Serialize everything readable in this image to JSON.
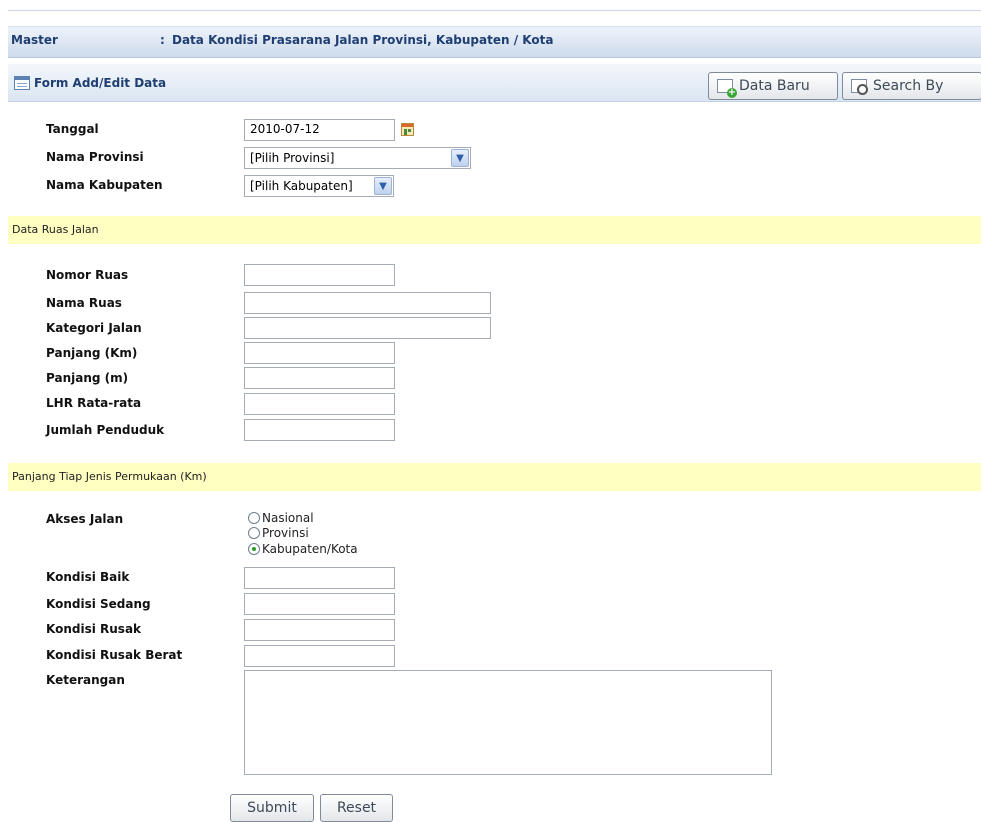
{
  "header": {
    "master_label": "Master",
    "separator": ":",
    "title": "Data Kondisi Prasarana Jalan Provinsi, Kabupaten / Kota"
  },
  "formbar": {
    "title": "Form Add/Edit Data",
    "new_button": "Data Baru",
    "search_button": "Search By"
  },
  "general": {
    "tanggal_label": "Tanggal",
    "tanggal_value": "2010-07-12",
    "provinsi_label": "Nama Provinsi",
    "provinsi_value": "[Pilih Provinsi]",
    "kabupaten_label": "Nama Kabupaten",
    "kabupaten_value": "[Pilih Kabupaten]"
  },
  "ruas_section": {
    "title": "Data Ruas Jalan",
    "nomor_ruas": "Nomor Ruas",
    "nama_ruas": "Nama Ruas",
    "kategori_jalan": "Kategori Jalan",
    "panjang_km": "Panjang (Km)",
    "panjang_m": "Panjang (m)",
    "lhr": "LHR Rata-rata",
    "jumlah_penduduk": "Jumlah Penduduk"
  },
  "permukaan_section": {
    "title": "Panjang Tiap Jenis Permukaan (Km)",
    "akses_jalan": "Akses Jalan",
    "radio_options": [
      "Nasional",
      "Provinsi",
      "Kabupaten/Kota"
    ],
    "selected": "Kabupaten/Kota",
    "kondisi_baik": "Kondisi Baik",
    "kondisi_sedang": "Kondisi Sedang",
    "kondisi_rusak": "Kondisi Rusak",
    "kondisi_rusak_berat": "Kondisi Rusak Berat",
    "keterangan": "Keterangan"
  },
  "actions": {
    "submit": "Submit",
    "reset": "Reset"
  },
  "colors": {
    "header_text": "#1f3f72",
    "section_bg": "#ffffc2"
  }
}
